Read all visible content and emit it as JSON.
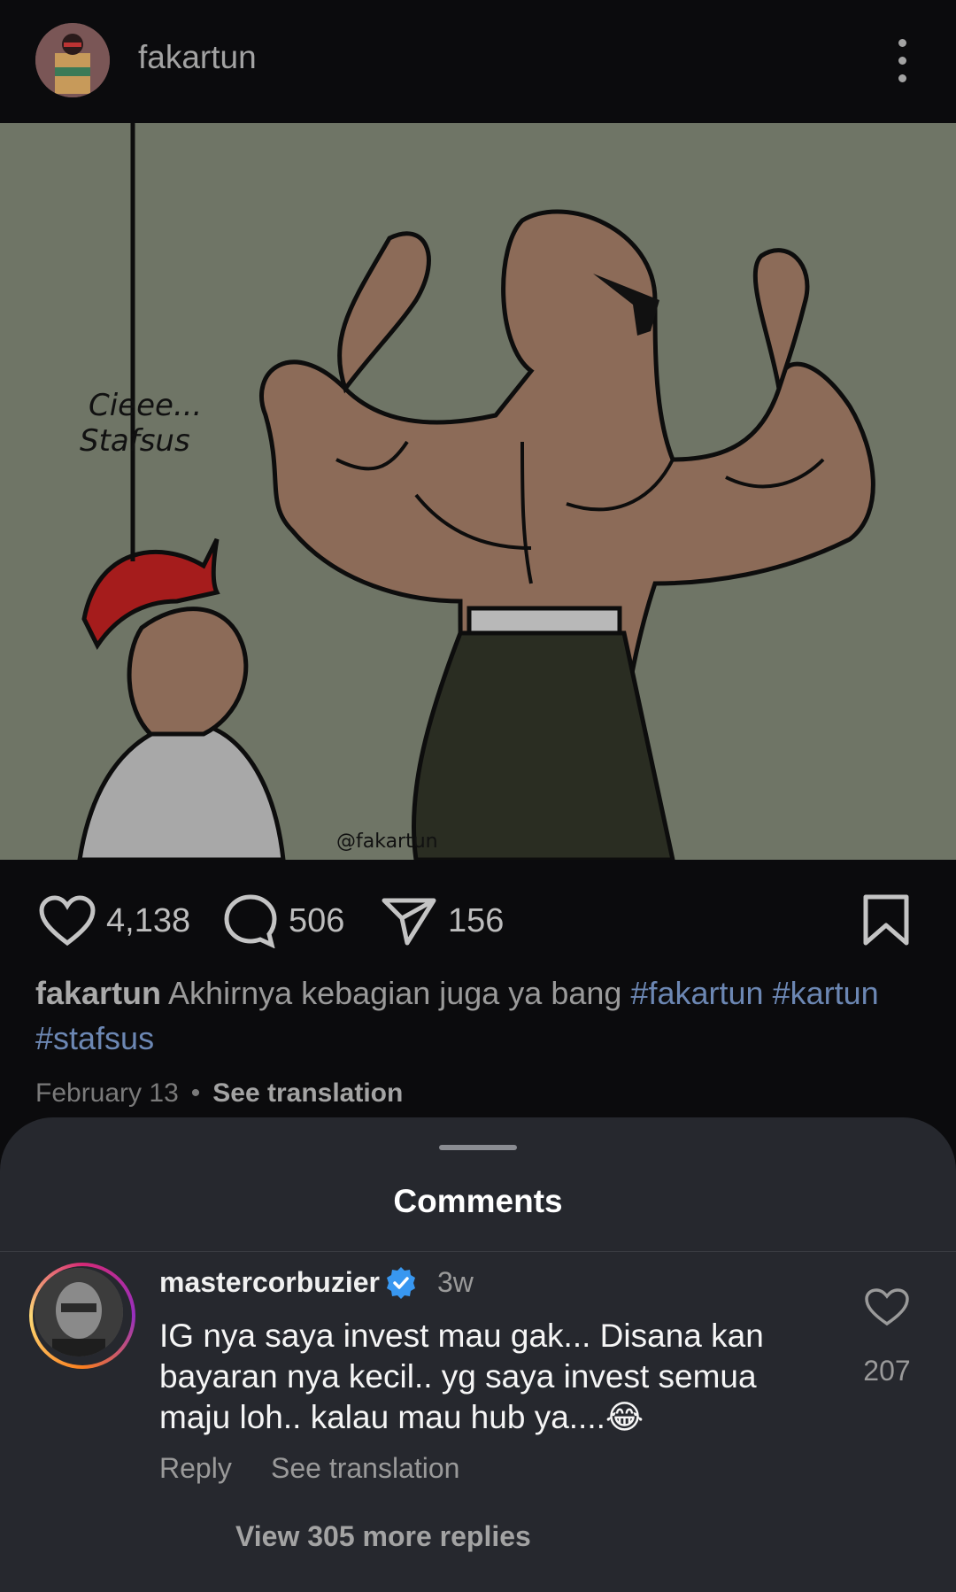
{
  "header": {
    "username": "fakartun"
  },
  "post": {
    "image_lettering": {
      "speech": [
        "Cieee...",
        "Stafsus"
      ],
      "watermark": "@fakartun"
    },
    "likes": "4,138",
    "comments": "506",
    "shares": "156",
    "caption_user": "fakartun",
    "caption_text": "Akhirnya kebagian juga ya bang",
    "hashtags": [
      "#fakartun",
      "#kartun",
      "#stafsus"
    ],
    "date": "February 13",
    "see_translation": "See translation"
  },
  "comments_sheet": {
    "title": "Comments",
    "comment": {
      "username": "mastercorbuzier",
      "time": "3w",
      "text": "IG nya saya invest mau gak... Disana kan bayaran nya kecil.. yg saya invest semua maju loh.. kalau mau hub ya....😂",
      "likes": "207",
      "reply_label": "Reply",
      "see_translation": "See translation",
      "view_more": "View 305 more replies"
    }
  },
  "colors": {
    "background": "#0b0b0d",
    "sheet": "#26282e",
    "hashtag": "#6c87b3",
    "verified": "#3897f0"
  }
}
